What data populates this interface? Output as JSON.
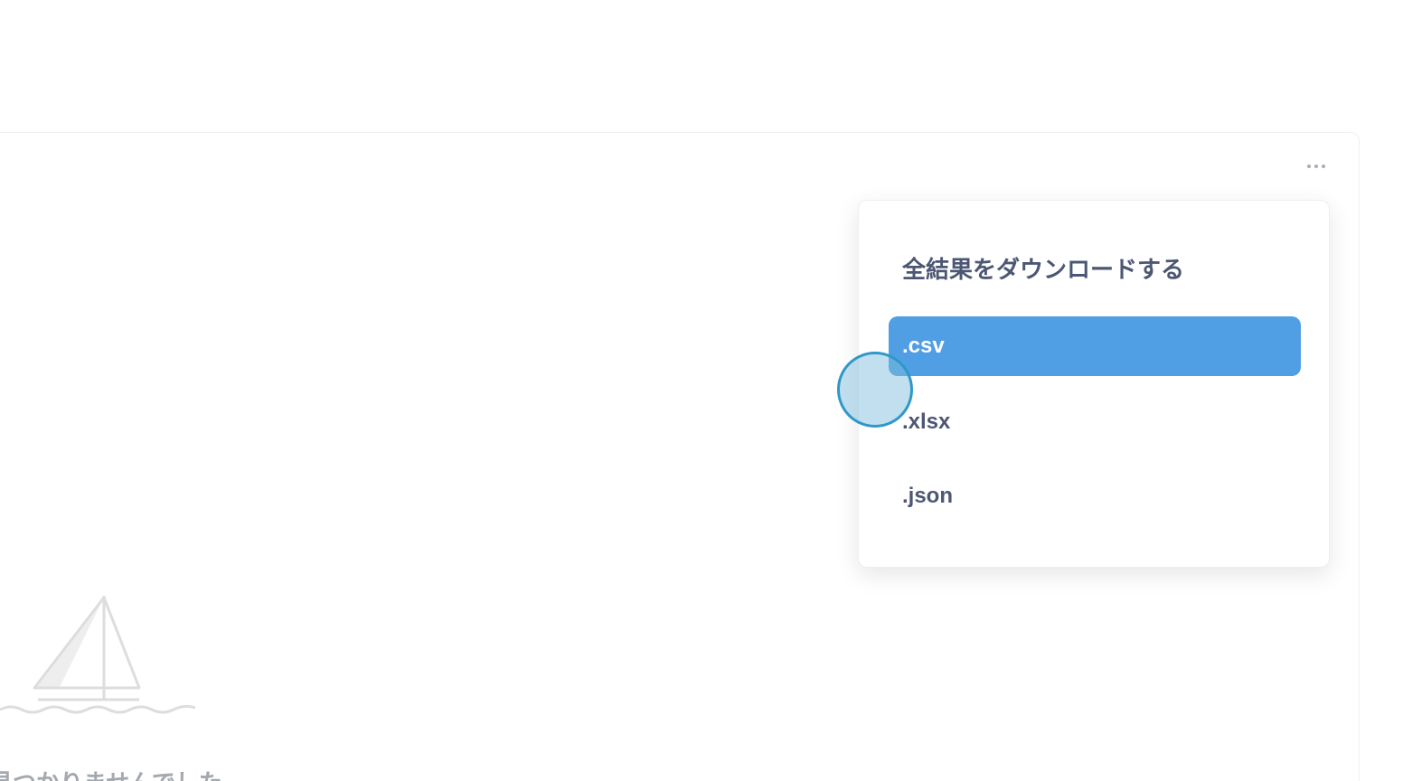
{
  "card": {
    "more_icon": "ellipsis-icon",
    "empty_state": {
      "illustration_icon": "sailboat-icon",
      "message": "見つかりませんでした"
    }
  },
  "download_menu": {
    "title": "全結果をダウンロードする",
    "items": [
      {
        "label": ".csv",
        "active": true
      },
      {
        "label": ".xlsx",
        "active": false
      },
      {
        "label": ".json",
        "active": false
      }
    ]
  },
  "colors": {
    "accent": "#509ee3",
    "text": "#4c5773",
    "muted_text": "#a4a9b0",
    "illustration": "#dddddd"
  }
}
